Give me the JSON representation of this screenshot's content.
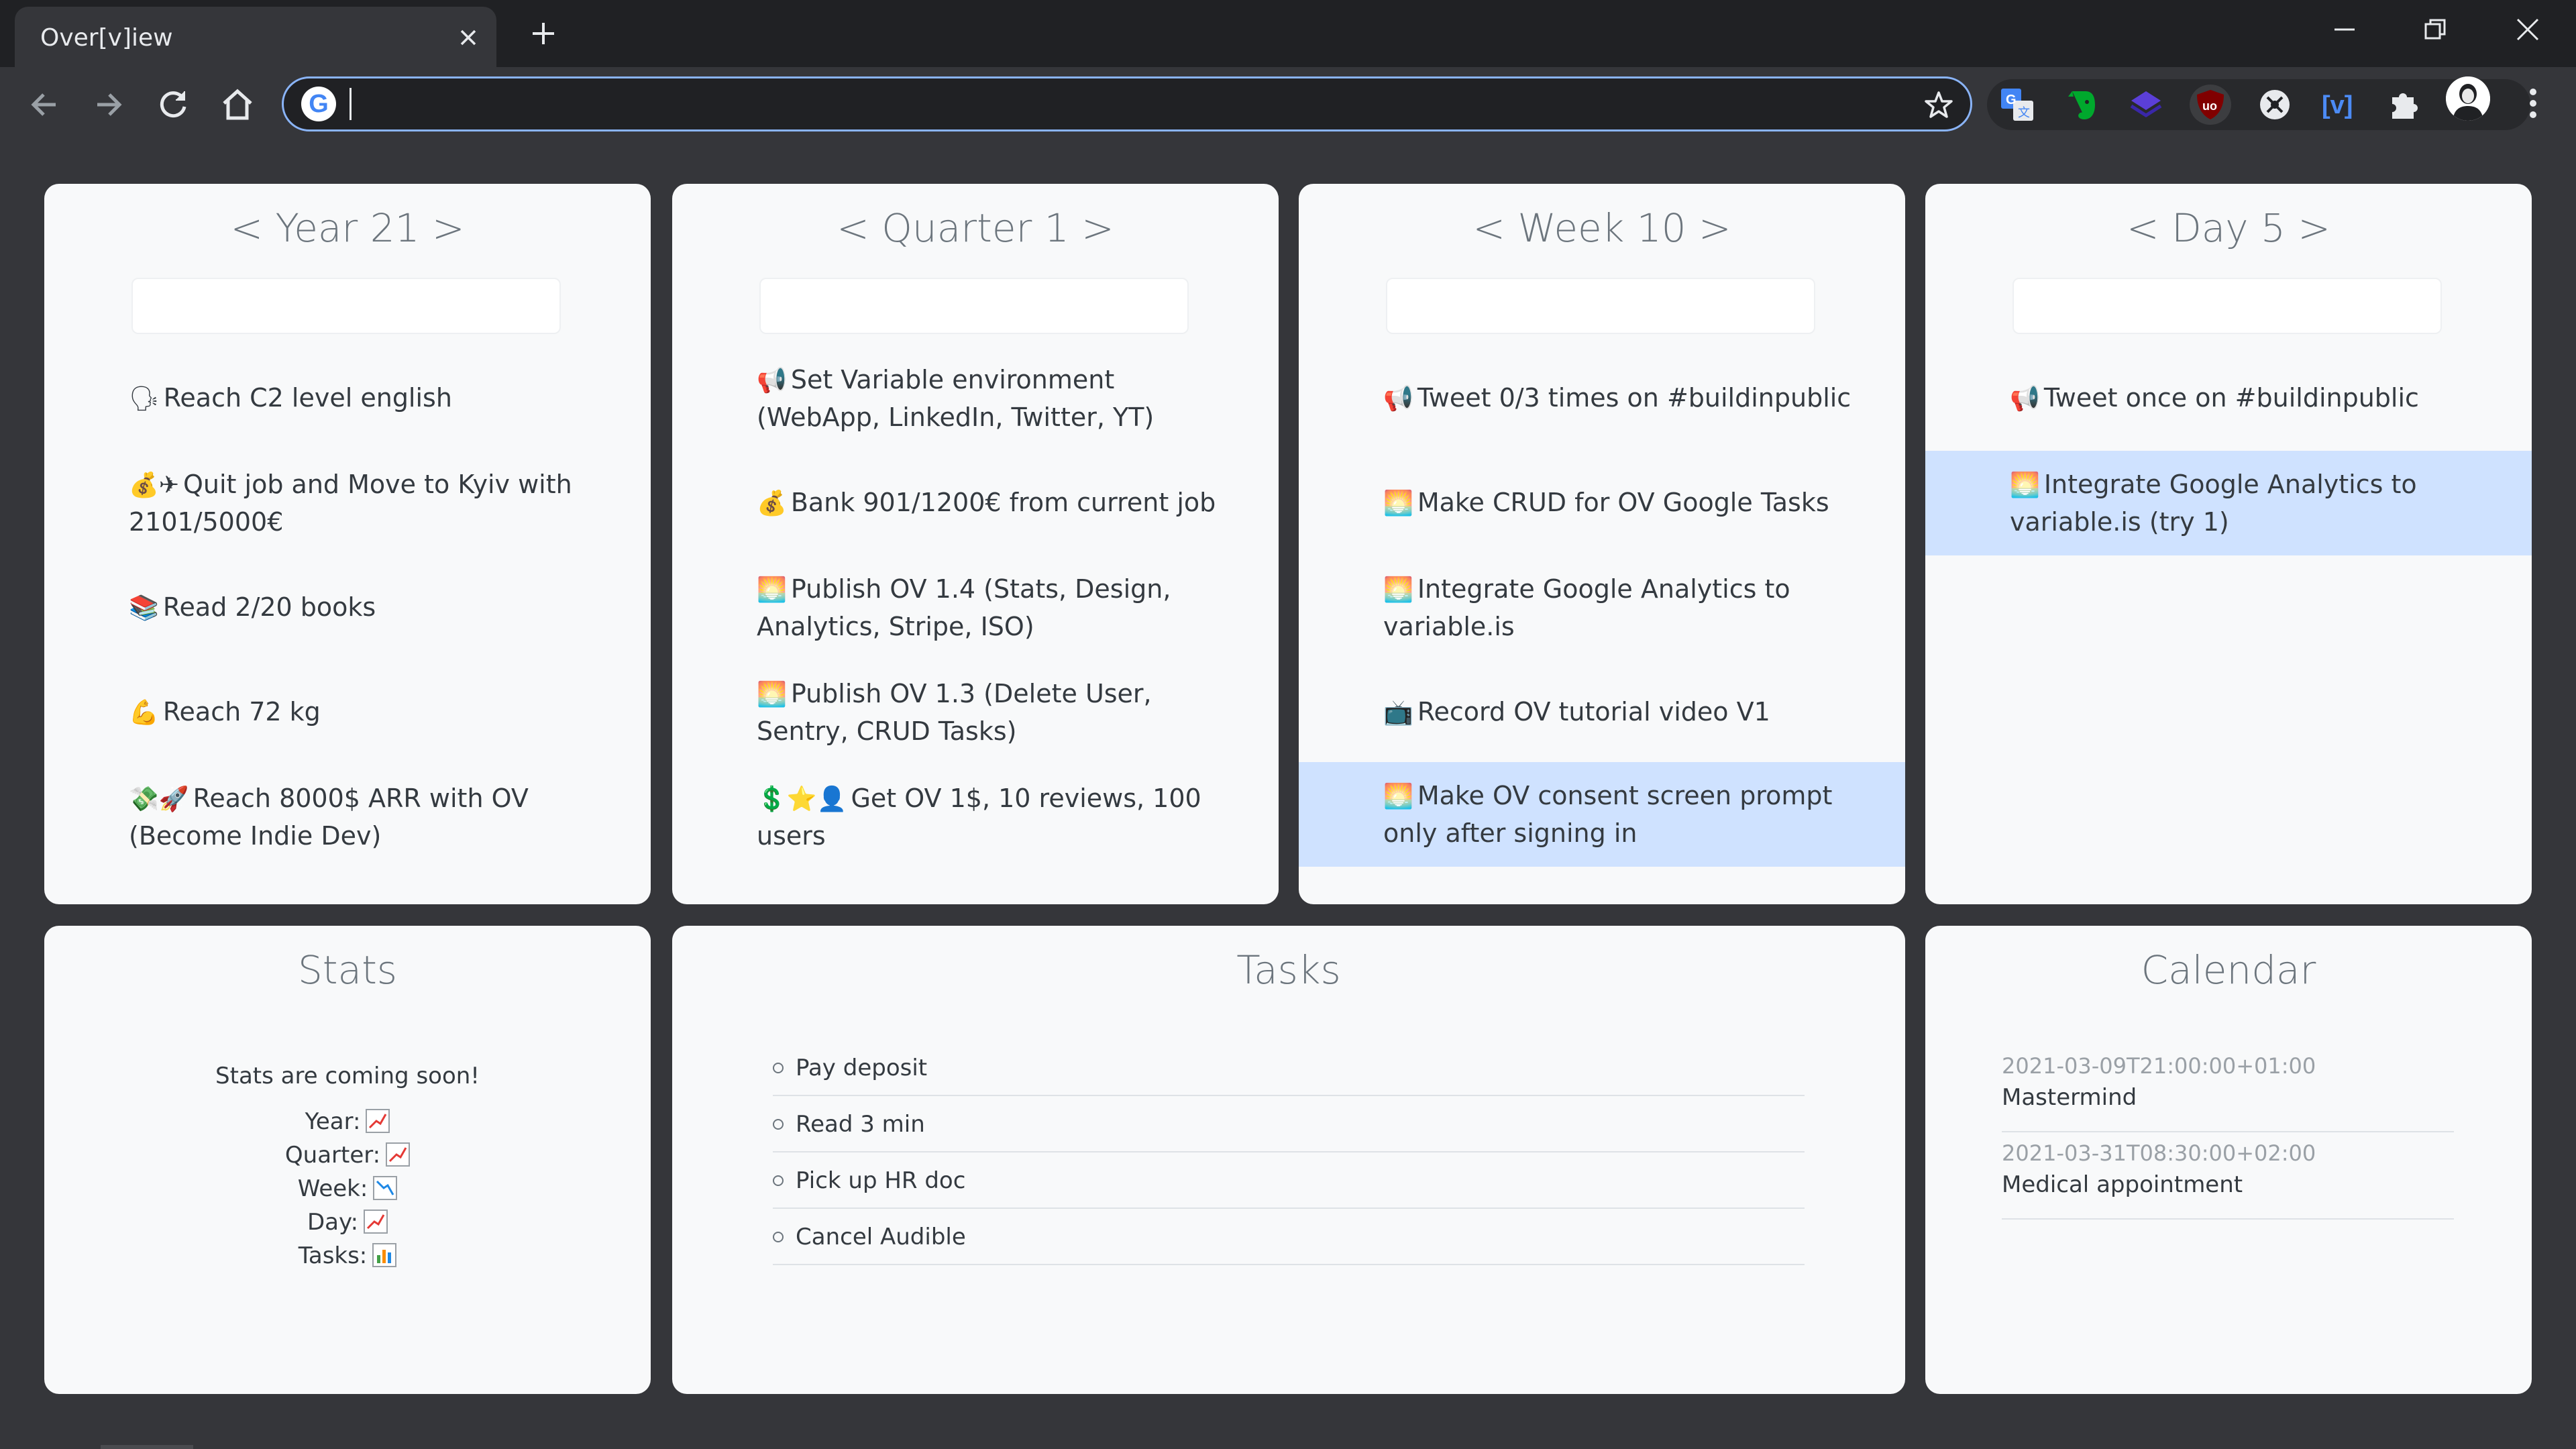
{
  "browser": {
    "tab_title": "Over[v]iew",
    "omnibox_value": "",
    "extensions": [
      "google-translate-icon",
      "evernote-icon",
      "stack-icon",
      "ublock-icon",
      "compass-icon",
      "variable-icon",
      "puzzle-icon"
    ],
    "accent": "#8ab4f8"
  },
  "year": {
    "title": "< Year 21 >",
    "input_value": "",
    "goals": [
      {
        "emoji": "🗣",
        "text": "Reach C2 level english"
      },
      {
        "emoji": "💰✈",
        "text": "Quit job and Move to Kyiv with 2101/5000€"
      },
      {
        "emoji": "📚",
        "text": "Read 2/20 books"
      },
      {
        "emoji": "💪",
        "text": "Reach 72 kg"
      },
      {
        "emoji": "💸🚀",
        "text": "Reach 8000$ ARR with OV (Become Indie Dev)"
      }
    ]
  },
  "quarter": {
    "title": "< Quarter 1 >",
    "input_value": "",
    "goals": [
      {
        "emoji": "📢",
        "text": "Set Variable environment (WebApp, LinkedIn, Twitter, YT)"
      },
      {
        "emoji": "💰",
        "text": "Bank 901/1200€ from current job"
      },
      {
        "emoji": "🌅",
        "text": "Publish OV 1.4 (Stats, Design, Analytics, Stripe, ISO)"
      },
      {
        "emoji": "🌅",
        "text": "Publish OV 1.3 (Delete User, Sentry, CRUD Tasks)"
      },
      {
        "emoji": "💲⭐👤",
        "text": "Get OV 1$, 10 reviews, 100 users"
      }
    ]
  },
  "week": {
    "title": "< Week 10 >",
    "input_value": "",
    "goals": [
      {
        "emoji": "📢",
        "text": "Tweet 0/3 times on #buildinpublic"
      },
      {
        "emoji": "🌅",
        "text": "Make CRUD for OV Google Tasks"
      },
      {
        "emoji": "🌅",
        "text": "Integrate Google Analytics to variable.is"
      },
      {
        "emoji": "📺",
        "text": "Record OV tutorial video V1"
      },
      {
        "emoji": "🌅",
        "text": "Make OV consent screen prompt only after signing in"
      }
    ]
  },
  "day": {
    "title": "< Day 5 >",
    "input_value": "",
    "goals": [
      {
        "emoji": "📢",
        "text": "Tweet once on #buildinpublic"
      },
      {
        "emoji": "🌅",
        "text": "Integrate Google Analytics to variable.is (try 1)"
      }
    ]
  },
  "stats": {
    "title": "Stats",
    "message": "Stats are coming soon!",
    "rows": [
      {
        "label": "Year:",
        "icon": "chart-increasing-icon"
      },
      {
        "label": "Quarter:",
        "icon": "chart-increasing-icon"
      },
      {
        "label": "Week:",
        "icon": "chart-decreasing-icon"
      },
      {
        "label": "Day:",
        "icon": "chart-increasing-icon"
      },
      {
        "label": "Tasks:",
        "icon": "bar-chart-icon"
      }
    ]
  },
  "tasks": {
    "title": "Tasks",
    "items": [
      "Pay deposit",
      "Read 3 min",
      "Pick up HR doc",
      "Cancel Audible"
    ]
  },
  "calendar": {
    "title": "Calendar",
    "events": [
      {
        "date": "2021-03-09T21:00:00+01:00",
        "name": "Mastermind"
      },
      {
        "date": "2021-03-31T08:30:00+02:00",
        "name": "Medical appointment"
      }
    ]
  }
}
